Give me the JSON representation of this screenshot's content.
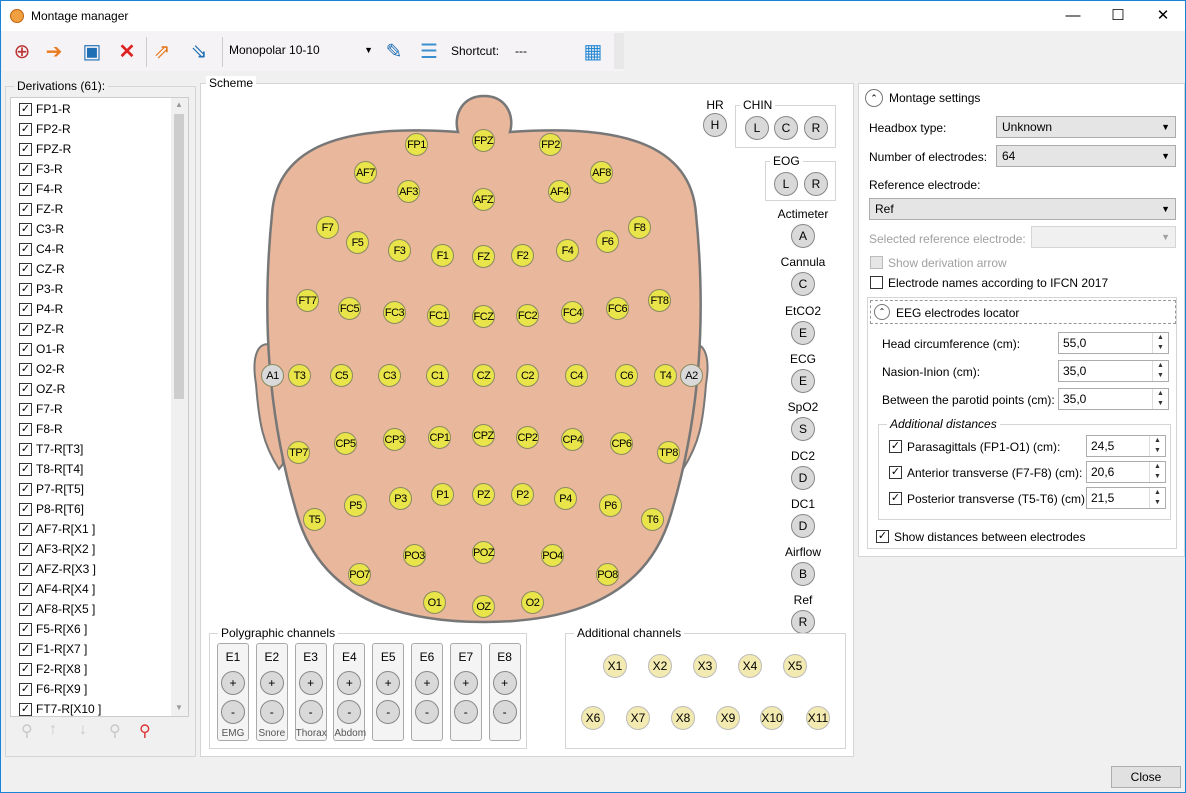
{
  "window": {
    "title": "Montage manager",
    "minimize": "—",
    "maximize": "☐",
    "close": "✕"
  },
  "toolbar": {
    "montage": "Monopolar 10-10",
    "shortcut_label": "Shortcut:",
    "shortcut_value": "---",
    "icons": [
      "add-montage-icon",
      "copy-montage-icon",
      "save-icon",
      "delete-icon",
      "export-icon",
      "import-icon",
      "edit-pencil-icon",
      "document-icon",
      "table-icon"
    ]
  },
  "derivations": {
    "title": "Derivations (61):",
    "items": [
      "FP1-R",
      "FP2-R",
      "FPZ-R",
      "F3-R",
      "F4-R",
      "FZ-R",
      "C3-R",
      "C4-R",
      "CZ-R",
      "P3-R",
      "P4-R",
      "PZ-R",
      "O1-R",
      "O2-R",
      "OZ-R",
      "F7-R",
      "F8-R",
      "T7-R[T3]",
      "T8-R[T4]",
      "P7-R[T5]",
      "P8-R[T6]",
      "AF7-R[X1 ]",
      "AF3-R[X2 ]",
      "AFZ-R[X3 ]",
      "AF4-R[X4 ]",
      "AF8-R[X5 ]",
      "F5-R[X6 ]",
      "F1-R[X7 ]",
      "F2-R[X8 ]",
      "F6-R[X9 ]",
      "FT7-R[X10 ]"
    ]
  },
  "scheme": {
    "title": "Scheme",
    "electrodes": [
      "FP1",
      "FPZ",
      "FP2",
      "AF7",
      "AF3",
      "AFZ",
      "AF4",
      "AF8",
      "F7",
      "F5",
      "F3",
      "F1",
      "FZ",
      "F2",
      "F4",
      "F6",
      "F8",
      "FT7",
      "FC5",
      "FC3",
      "FC1",
      "FCZ",
      "FC2",
      "FC4",
      "FC6",
      "FT8",
      "A1",
      "T3",
      "C5",
      "C3",
      "C1",
      "CZ",
      "C2",
      "C4",
      "C6",
      "T4",
      "A2",
      "TP7",
      "CP5",
      "CP3",
      "CP1",
      "CPZ",
      "CP2",
      "CP4",
      "CP6",
      "TP8",
      "T5",
      "P5",
      "P3",
      "P1",
      "PZ",
      "P2",
      "P4",
      "P6",
      "T6",
      "PO7",
      "PO3",
      "POZ",
      "PO4",
      "PO8",
      "O1",
      "OZ",
      "O2"
    ],
    "hr": {
      "label": "HR",
      "btn": "H"
    },
    "chin": {
      "label": "CHIN",
      "btns": [
        "L",
        "C",
        "R"
      ]
    },
    "eog": {
      "label": "EOG",
      "btns": [
        "L",
        "R"
      ]
    },
    "side": [
      {
        "label": "Actimeter",
        "btn": "A"
      },
      {
        "label": "Cannula",
        "btn": "C"
      },
      {
        "label": "EtCO2",
        "btn": "E"
      },
      {
        "label": "ECG",
        "btn": "E"
      },
      {
        "label": "SpO2",
        "btn": "S"
      },
      {
        "label": "DC2",
        "btn": "D"
      },
      {
        "label": "DC1",
        "btn": "D"
      },
      {
        "label": "Airflow",
        "btn": "B"
      },
      {
        "label": "Ref",
        "btn": "R"
      }
    ],
    "polygraphic": {
      "title": "Polygraphic channels",
      "plus": "+",
      "minus": "-",
      "channels": [
        {
          "name": "E1",
          "sub": "EMG"
        },
        {
          "name": "E2",
          "sub": "Snore"
        },
        {
          "name": "E3",
          "sub": "Thorax"
        },
        {
          "name": "E4",
          "sub": "Abdom"
        },
        {
          "name": "E5",
          "sub": ""
        },
        {
          "name": "E6",
          "sub": ""
        },
        {
          "name": "E7",
          "sub": ""
        },
        {
          "name": "E8",
          "sub": ""
        }
      ]
    },
    "additional": {
      "title": "Additional channels",
      "channels": [
        "X1",
        "X2",
        "X3",
        "X4",
        "X5",
        "X6",
        "X7",
        "X8",
        "X9",
        "X10",
        "X11"
      ]
    }
  },
  "settings": {
    "title": "Montage settings",
    "headbox_label": "Headbox type:",
    "headbox": "Unknown",
    "num_label": "Number of electrodes:",
    "num": "64",
    "ref_label": "Reference electrode:",
    "ref": "Ref",
    "sel_ref_label": "Selected reference electrode:",
    "sel_ref": "",
    "show_arrow": "Show derivation arrow",
    "ifcn": "Electrode names according to IFCN 2017",
    "locator": {
      "title": "EEG electrodes locator",
      "head_circ_label": "Head circumference (cm):",
      "head_circ": "55,0",
      "nasion_label": "Nasion-Inion (cm):",
      "nasion": "35,0",
      "parotid_label": "Between the parotid points (cm):",
      "parotid": "35,0",
      "additional_title": "Additional distances",
      "para_label": "Parasagittals (FP1-O1) (cm):",
      "para": "24,5",
      "ant_label": "Anterior transverse (F7-F8) (cm):",
      "ant": "20,6",
      "post_label": "Posterior transverse (T5-T6) (cm):",
      "post": "21,5"
    },
    "show_distances": "Show distances between electrodes"
  },
  "close_button": "Close",
  "colors": {
    "electrode": "#e8e44a",
    "head": "#e8b79c",
    "additional": "#f2eab0"
  }
}
